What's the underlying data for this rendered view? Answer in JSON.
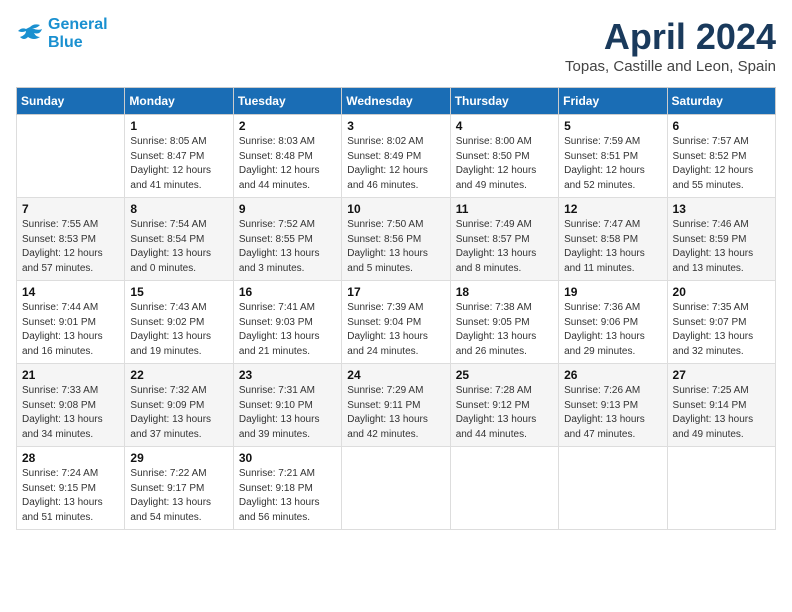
{
  "header": {
    "logo_line1": "General",
    "logo_line2": "Blue",
    "month_title": "April 2024",
    "location": "Topas, Castille and Leon, Spain"
  },
  "weekdays": [
    "Sunday",
    "Monday",
    "Tuesday",
    "Wednesday",
    "Thursday",
    "Friday",
    "Saturday"
  ],
  "weeks": [
    [
      {
        "day": "",
        "info": ""
      },
      {
        "day": "1",
        "info": "Sunrise: 8:05 AM\nSunset: 8:47 PM\nDaylight: 12 hours\nand 41 minutes."
      },
      {
        "day": "2",
        "info": "Sunrise: 8:03 AM\nSunset: 8:48 PM\nDaylight: 12 hours\nand 44 minutes."
      },
      {
        "day": "3",
        "info": "Sunrise: 8:02 AM\nSunset: 8:49 PM\nDaylight: 12 hours\nand 46 minutes."
      },
      {
        "day": "4",
        "info": "Sunrise: 8:00 AM\nSunset: 8:50 PM\nDaylight: 12 hours\nand 49 minutes."
      },
      {
        "day": "5",
        "info": "Sunrise: 7:59 AM\nSunset: 8:51 PM\nDaylight: 12 hours\nand 52 minutes."
      },
      {
        "day": "6",
        "info": "Sunrise: 7:57 AM\nSunset: 8:52 PM\nDaylight: 12 hours\nand 55 minutes."
      }
    ],
    [
      {
        "day": "7",
        "info": "Sunrise: 7:55 AM\nSunset: 8:53 PM\nDaylight: 12 hours\nand 57 minutes."
      },
      {
        "day": "8",
        "info": "Sunrise: 7:54 AM\nSunset: 8:54 PM\nDaylight: 13 hours\nand 0 minutes."
      },
      {
        "day": "9",
        "info": "Sunrise: 7:52 AM\nSunset: 8:55 PM\nDaylight: 13 hours\nand 3 minutes."
      },
      {
        "day": "10",
        "info": "Sunrise: 7:50 AM\nSunset: 8:56 PM\nDaylight: 13 hours\nand 5 minutes."
      },
      {
        "day": "11",
        "info": "Sunrise: 7:49 AM\nSunset: 8:57 PM\nDaylight: 13 hours\nand 8 minutes."
      },
      {
        "day": "12",
        "info": "Sunrise: 7:47 AM\nSunset: 8:58 PM\nDaylight: 13 hours\nand 11 minutes."
      },
      {
        "day": "13",
        "info": "Sunrise: 7:46 AM\nSunset: 8:59 PM\nDaylight: 13 hours\nand 13 minutes."
      }
    ],
    [
      {
        "day": "14",
        "info": "Sunrise: 7:44 AM\nSunset: 9:01 PM\nDaylight: 13 hours\nand 16 minutes."
      },
      {
        "day": "15",
        "info": "Sunrise: 7:43 AM\nSunset: 9:02 PM\nDaylight: 13 hours\nand 19 minutes."
      },
      {
        "day": "16",
        "info": "Sunrise: 7:41 AM\nSunset: 9:03 PM\nDaylight: 13 hours\nand 21 minutes."
      },
      {
        "day": "17",
        "info": "Sunrise: 7:39 AM\nSunset: 9:04 PM\nDaylight: 13 hours\nand 24 minutes."
      },
      {
        "day": "18",
        "info": "Sunrise: 7:38 AM\nSunset: 9:05 PM\nDaylight: 13 hours\nand 26 minutes."
      },
      {
        "day": "19",
        "info": "Sunrise: 7:36 AM\nSunset: 9:06 PM\nDaylight: 13 hours\nand 29 minutes."
      },
      {
        "day": "20",
        "info": "Sunrise: 7:35 AM\nSunset: 9:07 PM\nDaylight: 13 hours\nand 32 minutes."
      }
    ],
    [
      {
        "day": "21",
        "info": "Sunrise: 7:33 AM\nSunset: 9:08 PM\nDaylight: 13 hours\nand 34 minutes."
      },
      {
        "day": "22",
        "info": "Sunrise: 7:32 AM\nSunset: 9:09 PM\nDaylight: 13 hours\nand 37 minutes."
      },
      {
        "day": "23",
        "info": "Sunrise: 7:31 AM\nSunset: 9:10 PM\nDaylight: 13 hours\nand 39 minutes."
      },
      {
        "day": "24",
        "info": "Sunrise: 7:29 AM\nSunset: 9:11 PM\nDaylight: 13 hours\nand 42 minutes."
      },
      {
        "day": "25",
        "info": "Sunrise: 7:28 AM\nSunset: 9:12 PM\nDaylight: 13 hours\nand 44 minutes."
      },
      {
        "day": "26",
        "info": "Sunrise: 7:26 AM\nSunset: 9:13 PM\nDaylight: 13 hours\nand 47 minutes."
      },
      {
        "day": "27",
        "info": "Sunrise: 7:25 AM\nSunset: 9:14 PM\nDaylight: 13 hours\nand 49 minutes."
      }
    ],
    [
      {
        "day": "28",
        "info": "Sunrise: 7:24 AM\nSunset: 9:15 PM\nDaylight: 13 hours\nand 51 minutes."
      },
      {
        "day": "29",
        "info": "Sunrise: 7:22 AM\nSunset: 9:17 PM\nDaylight: 13 hours\nand 54 minutes."
      },
      {
        "day": "30",
        "info": "Sunrise: 7:21 AM\nSunset: 9:18 PM\nDaylight: 13 hours\nand 56 minutes."
      },
      {
        "day": "",
        "info": ""
      },
      {
        "day": "",
        "info": ""
      },
      {
        "day": "",
        "info": ""
      },
      {
        "day": "",
        "info": ""
      }
    ]
  ]
}
